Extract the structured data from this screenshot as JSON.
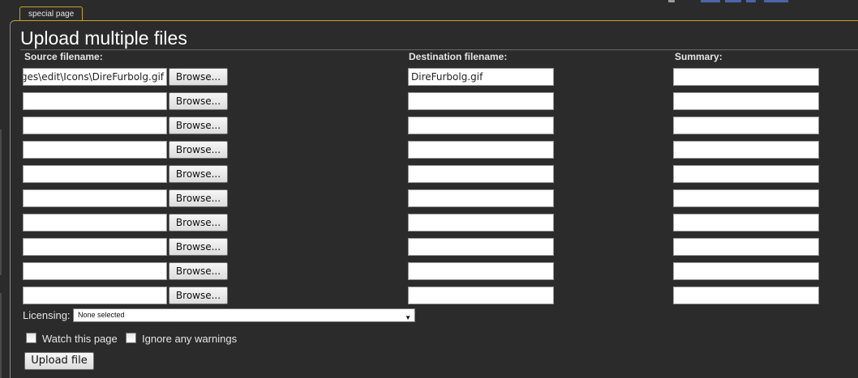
{
  "tab": {
    "label": "special page"
  },
  "page_title": "Upload multiple files",
  "columns": {
    "source": "Source filename:",
    "destination": "Destination filename:",
    "summary": "Summary:"
  },
  "rows": [
    {
      "source": "C:\\Users\\Wes\\Pictures\\wiki\\images\\edit\\Icons\\DireFurbolg.gif",
      "browse": "Browse...",
      "destination": "DireFurbolg.gif",
      "summary": ""
    },
    {
      "source": "",
      "browse": "Browse...",
      "destination": "",
      "summary": ""
    },
    {
      "source": "",
      "browse": "Browse...",
      "destination": "",
      "summary": ""
    },
    {
      "source": "",
      "browse": "Browse...",
      "destination": "",
      "summary": ""
    },
    {
      "source": "",
      "browse": "Browse...",
      "destination": "",
      "summary": ""
    },
    {
      "source": "",
      "browse": "Browse...",
      "destination": "",
      "summary": ""
    },
    {
      "source": "",
      "browse": "Browse...",
      "destination": "",
      "summary": ""
    },
    {
      "source": "",
      "browse": "Browse...",
      "destination": "",
      "summary": ""
    },
    {
      "source": "",
      "browse": "Browse...",
      "destination": "",
      "summary": ""
    },
    {
      "source": "",
      "browse": "Browse...",
      "destination": "",
      "summary": ""
    }
  ],
  "licensing": {
    "label": "Licensing:",
    "selected": "None selected"
  },
  "options": {
    "watch_label": "Watch this page",
    "ignore_label": "Ignore any warnings"
  },
  "upload_button": "Upload file",
  "colors": {
    "background": "#2b2b2b",
    "tab_border": "#c9a227",
    "text": "#e6e6e6"
  }
}
